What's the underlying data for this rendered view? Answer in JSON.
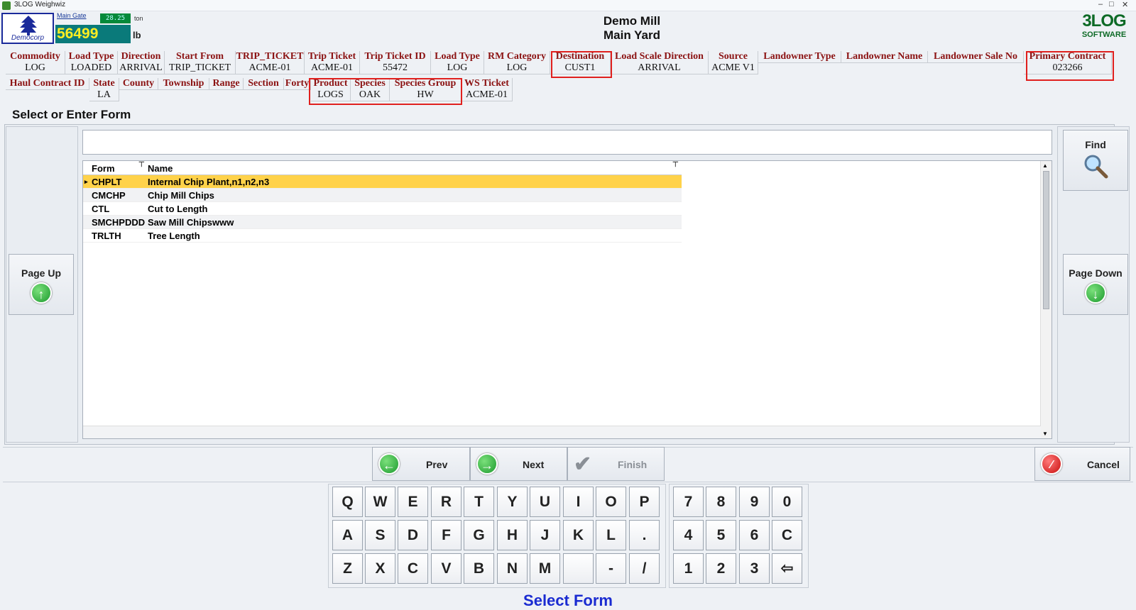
{
  "window": {
    "title": "3LOG Weighwiz",
    "minimize": "–",
    "maximize": "□",
    "close": "✕"
  },
  "header": {
    "company_logo_text": "Democorp",
    "gate_label": "Main Gate",
    "speed_display": "28.25",
    "unit_ton": "ton",
    "weight": "56499",
    "unit_lb": "lb",
    "mill_name": "Demo Mill",
    "yard_name": "Main Yard",
    "brand_line1": "3LOG",
    "brand_line2": "SOFTWARE"
  },
  "info_row1": [
    {
      "label": "Commodity",
      "value": "LOG"
    },
    {
      "label": "Load Type",
      "value": "LOADED"
    },
    {
      "label": "Direction",
      "value": "ARRIVAL"
    },
    {
      "label": "Start From",
      "value": "TRIP_TICKET"
    },
    {
      "label": "TRIP_TICKET",
      "value": "ACME-01"
    },
    {
      "label": "Trip Ticket",
      "value": "ACME-01"
    },
    {
      "label": "Trip Ticket ID",
      "value": "55472"
    },
    {
      "label": "Load Type",
      "value": "LOG"
    },
    {
      "label": "RM Category",
      "value": "LOG"
    },
    {
      "label": "Destination",
      "value": "CUST1"
    },
    {
      "label": "Load Scale Direction",
      "value": "ARRIVAL"
    },
    {
      "label": "Source",
      "value": "ACME V1"
    },
    {
      "label": "Landowner Type",
      "value": ""
    },
    {
      "label": "Landowner Name",
      "value": ""
    },
    {
      "label": "Landowner Sale No",
      "value": ""
    },
    {
      "label": "Primary Contract",
      "value": "023266"
    }
  ],
  "info_row2": [
    {
      "label": "Haul Contract ID",
      "value": ""
    },
    {
      "label": "State",
      "value": "LA"
    },
    {
      "label": "County",
      "value": ""
    },
    {
      "label": "Township",
      "value": ""
    },
    {
      "label": "Range",
      "value": ""
    },
    {
      "label": "Section",
      "value": ""
    },
    {
      "label": "Forty",
      "value": ""
    },
    {
      "label": "Product",
      "value": "LOGS"
    },
    {
      "label": "Species",
      "value": "OAK"
    },
    {
      "label": "Species Group",
      "value": "HW"
    },
    {
      "label": "WS Ticket",
      "value": "ACME-01"
    }
  ],
  "section_title": "Select or Enter Form",
  "search": {
    "value": ""
  },
  "grid": {
    "columns": [
      "Form",
      "Name"
    ],
    "rows": [
      {
        "form": "CHPLT",
        "name": "Internal Chip Plant,n1,n2,n3",
        "selected": true
      },
      {
        "form": "CMCHP",
        "name": "Chip Mill Chips",
        "selected": false
      },
      {
        "form": "CTL",
        "name": "Cut to Length",
        "selected": false
      },
      {
        "form": "SMCHPDDD",
        "name": "Saw Mill Chipswww",
        "selected": false
      },
      {
        "form": "TRLTH",
        "name": "Tree Length",
        "selected": false
      }
    ]
  },
  "buttons": {
    "find": "Find",
    "page_up": "Page Up",
    "page_down": "Page Down",
    "prev": "Prev",
    "next": "Next",
    "finish": "Finish",
    "cancel": "Cancel"
  },
  "keyboard": {
    "row1": [
      "Q",
      "W",
      "E",
      "R",
      "T",
      "Y",
      "U",
      "I",
      "O",
      "P"
    ],
    "row2": [
      "A",
      "S",
      "D",
      "F",
      "G",
      "H",
      "J",
      "K",
      "L",
      "."
    ],
    "row3": [
      "Z",
      "X",
      "C",
      "V",
      "B",
      "N",
      "M",
      " ",
      "-",
      "/"
    ],
    "num1": [
      "7",
      "8",
      "9",
      "0"
    ],
    "num2": [
      "4",
      "5",
      "6",
      "C"
    ],
    "num3": [
      "1",
      "2",
      "3",
      "⇦"
    ]
  },
  "status_text": "Select Form",
  "colors": {
    "field_label": "#8b1212",
    "highlight_box": "#e0201e",
    "selected_row": "#ffd24a",
    "status": "#1a2bd1"
  }
}
